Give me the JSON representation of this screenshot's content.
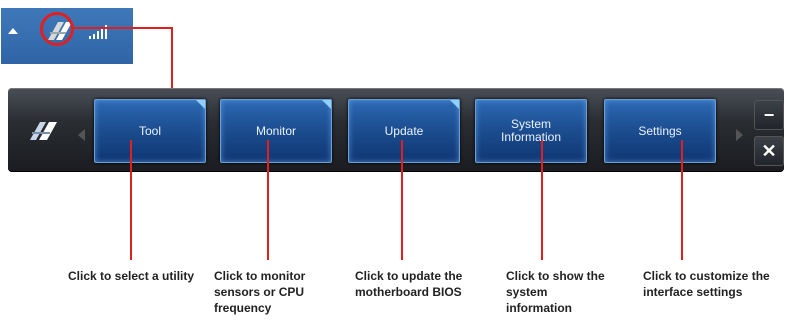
{
  "toolbar": {
    "buttons": [
      {
        "label": "Tool",
        "has_corner": true
      },
      {
        "label": "Monitor",
        "has_corner": true
      },
      {
        "label": "Update",
        "has_corner": true
      },
      {
        "label": "System Information",
        "has_corner": false
      },
      {
        "label": "Settings",
        "has_corner": false
      }
    ],
    "minimize_label": "−",
    "close_label": "✕"
  },
  "captions": [
    {
      "text": "Click to select a utility"
    },
    {
      "text": "Click to monitor sensors or CPU frequency"
    },
    {
      "text": "Click to update the motherboard BIOS"
    },
    {
      "text": "Click to show the system information"
    },
    {
      "text": "Click to customize the interface settings"
    }
  ],
  "colors": {
    "accent_line": "#e02020",
    "tray_bg": "#3a72b3",
    "button_blue": "#1d4f92",
    "toolbar_dark": "#2a2d32"
  },
  "icons": {
    "tray_arrow": "up-triangle-icon",
    "tray_app": "ai-suite-logo-icon",
    "tray_signal": "signal-strength-icon",
    "toolbar_logo": "ai-suite-logo-icon"
  }
}
